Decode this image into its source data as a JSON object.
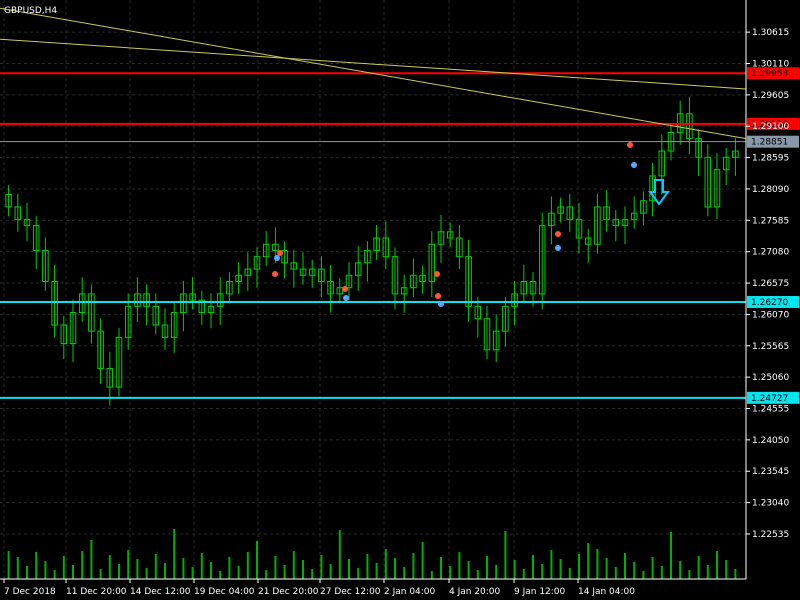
{
  "symbol_label": "GBPUSD,H4",
  "colors": {
    "background": "#000000",
    "grid": "#2a2a2a",
    "candle": "#00d000",
    "red_line": "#ff0000",
    "cyan_line": "#00e5ee",
    "trend_line": "#cccc55",
    "current_line": "#8899aa",
    "axis_text": "#ffffff",
    "volume": "#00b000",
    "sell_arrow": "#00ccff"
  },
  "chart_data": {
    "type": "candlestick",
    "ylim": [
      1.2181,
      1.311
    ],
    "y_ticks": [
      "1.30615",
      "1.30110",
      "1.29605",
      "1.29100",
      "1.28595",
      "1.28090",
      "1.27585",
      "1.27080",
      "1.26575",
      "1.26070",
      "1.25565",
      "1.25060",
      "1.24555",
      "1.24050",
      "1.23545",
      "1.23040",
      "1.22535"
    ],
    "x_ticks": [
      "7 Dec 2018",
      "11 Dec 20:00",
      "14 Dec 12:00",
      "19 Dec 04:00",
      "21 Dec 20:00",
      "27 Dec 12:00",
      "2 Jan 04:00",
      "4 Jan 20:00",
      "9 Jan 12:00",
      "14 Jan 04:00"
    ],
    "horizontal_lines": [
      {
        "label": "1.29953",
        "price": 1.29953,
        "color": "red_line"
      },
      {
        "label": "1.29138",
        "price": 1.29138,
        "color": "red_line"
      },
      {
        "label": "1.28851",
        "price": 1.28851,
        "color": "current_line"
      },
      {
        "label": "1.26270",
        "price": 1.2627,
        "color": "cyan_line"
      },
      {
        "label": "1.24727",
        "price": 1.24727,
        "color": "cyan_line"
      }
    ],
    "trendlines": [
      {
        "from": [
          0,
          1.305
        ],
        "to": [
          1,
          1.297
        ]
      },
      {
        "from": [
          0,
          1.31
        ],
        "to": [
          1,
          1.289
        ]
      }
    ],
    "closes": [
      1.278,
      1.276,
      1.275,
      1.271,
      1.266,
      1.259,
      1.256,
      1.261,
      1.264,
      1.258,
      1.252,
      1.249,
      1.257,
      1.262,
      1.264,
      1.262,
      1.259,
      1.257,
      1.261,
      1.264,
      1.263,
      1.261,
      1.262,
      1.264,
      1.266,
      1.267,
      1.268,
      1.27,
      1.272,
      1.271,
      1.269,
      1.268,
      1.267,
      1.268,
      1.266,
      1.264,
      1.265,
      1.267,
      1.269,
      1.271,
      1.273,
      1.27,
      1.264,
      1.265,
      1.267,
      1.266,
      1.272,
      1.274,
      1.273,
      1.27,
      1.262,
      1.26,
      1.255,
      1.258,
      1.262,
      1.264,
      1.266,
      1.264,
      1.275,
      1.277,
      1.278,
      1.276,
      1.273,
      1.272,
      1.278,
      1.276,
      1.275,
      1.276,
      1.277,
      1.279,
      1.283,
      1.287,
      1.29,
      1.293,
      1.289,
      1.286,
      1.278,
      1.284,
      1.286,
      1.287
    ]
  }
}
